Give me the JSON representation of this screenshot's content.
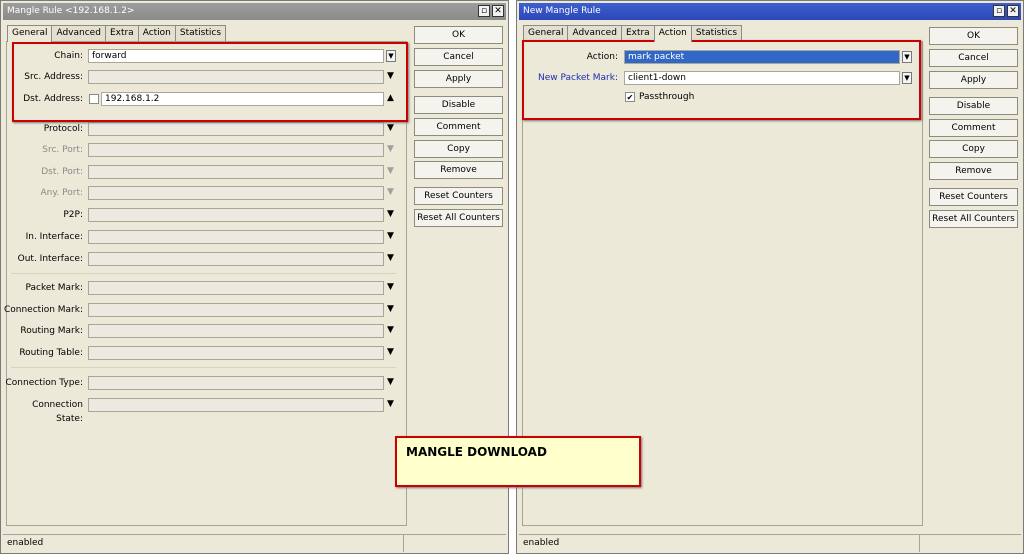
{
  "left_window": {
    "title": "Mangle Rule <192.168.1.2>",
    "tabs": [
      "General",
      "Advanced",
      "Extra",
      "Action",
      "Statistics"
    ],
    "active_tab": "General",
    "fields": {
      "chain": {
        "label": "Chain:",
        "value": "forward"
      },
      "src_address": {
        "label": "Src. Address:",
        "value": ""
      },
      "dst_address": {
        "label": "Dst. Address:",
        "value": "192.168.1.2"
      },
      "protocol": {
        "label": "Protocol:",
        "value": ""
      },
      "src_port": {
        "label": "Src. Port:",
        "value": ""
      },
      "dst_port": {
        "label": "Dst. Port:",
        "value": ""
      },
      "any_port": {
        "label": "Any. Port:",
        "value": ""
      },
      "p2p": {
        "label": "P2P:",
        "value": ""
      },
      "in_interface": {
        "label": "In. Interface:",
        "value": ""
      },
      "out_interface": {
        "label": "Out. Interface:",
        "value": ""
      },
      "packet_mark": {
        "label": "Packet Mark:",
        "value": ""
      },
      "connection_mark": {
        "label": "Connection Mark:",
        "value": ""
      },
      "routing_mark": {
        "label": "Routing Mark:",
        "value": ""
      },
      "routing_table": {
        "label": "Routing Table:",
        "value": ""
      },
      "connection_type": {
        "label": "Connection Type:",
        "value": ""
      },
      "connection_state": {
        "label": "Connection State:",
        "value": ""
      }
    },
    "buttons": [
      "OK",
      "Cancel",
      "Apply",
      "Disable",
      "Comment",
      "Copy",
      "Remove",
      "Reset Counters",
      "Reset All Counters"
    ],
    "status": "enabled"
  },
  "right_window": {
    "title": "New Mangle Rule",
    "tabs": [
      "General",
      "Advanced",
      "Extra",
      "Action",
      "Statistics"
    ],
    "active_tab": "Action",
    "fields": {
      "action": {
        "label": "Action:",
        "value": "mark packet"
      },
      "new_packet_mark": {
        "label": "New Packet Mark:",
        "value": "client1-down"
      },
      "passthrough": {
        "label": "Passthrough",
        "checked": true
      }
    },
    "buttons": [
      "OK",
      "Cancel",
      "Apply",
      "Disable",
      "Comment",
      "Copy",
      "Remove",
      "Reset Counters",
      "Reset All Counters"
    ],
    "status": "enabled"
  },
  "annotation": "MANGLE DOWNLOAD",
  "icons": {
    "minimize": "minimize-icon",
    "close": "close-icon",
    "dropdown": "dropdown-arrow-icon",
    "check": "check-icon"
  },
  "colors": {
    "title_active": "#2d48b8",
    "title_inactive": "#8a8a8a",
    "highlight_box": "#cc0000",
    "note_bg": "#ffffcc",
    "selection": "#3168c8"
  }
}
